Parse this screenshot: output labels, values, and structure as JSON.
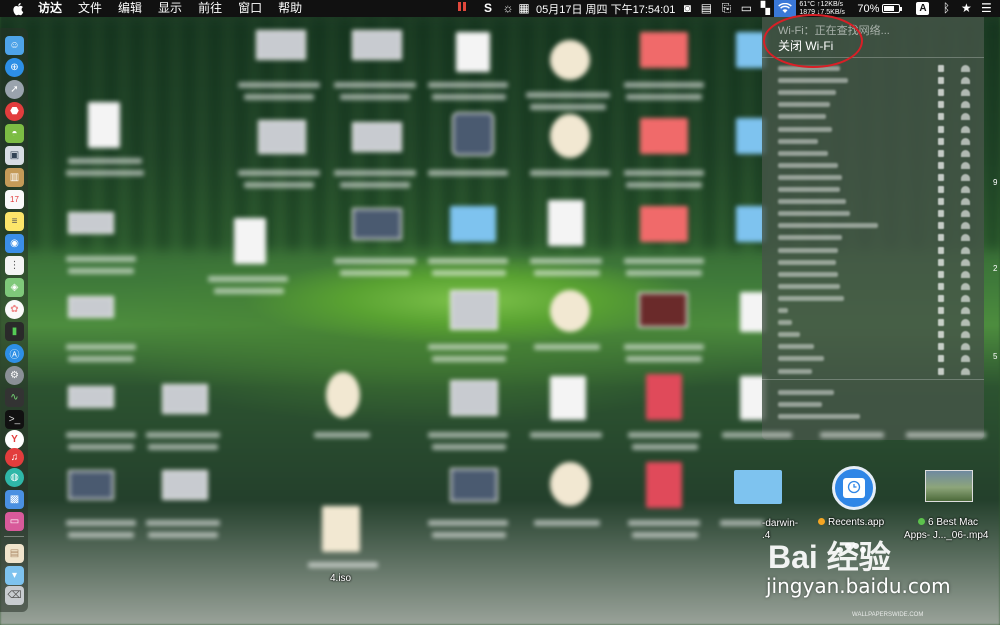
{
  "menubar": {
    "items": [
      "访达",
      "文件",
      "编辑",
      "显示",
      "前往",
      "窗口",
      "帮助"
    ],
    "datetime": "05月17日 周四 下午17:54:01",
    "stats_line1": "61°C ↑12KB/s",
    "stats_line2": "1879 ↓7.5KB/s",
    "battery_percent": "70%",
    "battery_level": 0.7,
    "input_method": "A"
  },
  "wifi_menu": {
    "status": "Wi-Fi：正在查找网络...",
    "toggle": "关闭 Wi-Fi",
    "network_count": 26,
    "footer_item_count": 3
  },
  "desktop_right": {
    "item1_label": "-darwin-\n.4",
    "item2_label": "Recents.app",
    "item3_label_line1": "6 Best Mac",
    "item3_label_line2": "Apps- J..._06-.mp4",
    "dot_orange": "#f5a623",
    "dot_green": "#5cc24c"
  },
  "iso_label": "4.iso",
  "watermark": {
    "brand": "Bai 经验",
    "url": "jingyan.baidu.com",
    "small": "WALLPAPERSWIDE.COM"
  },
  "edge_digits": [
    "9",
    "2",
    "5"
  ],
  "colors": {
    "highlight": "#3a78d8",
    "annotation": "#d81f26",
    "recording": "#e0483c"
  }
}
